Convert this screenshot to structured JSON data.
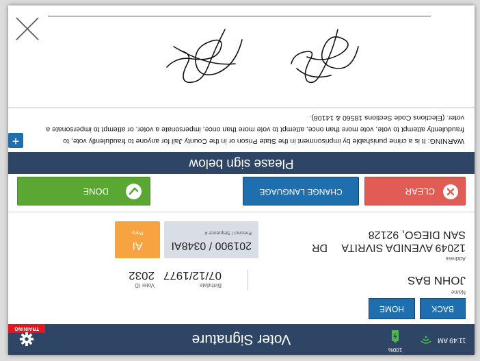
{
  "header": {
    "title": "Voter Signature",
    "training_label": "TRAINING",
    "battery_percent": "100%",
    "time": "11:49 AM",
    "colors": {
      "bar": "#2e4565",
      "training": "#e4161b"
    }
  },
  "nav": {
    "back_label": "BACK",
    "home_label": "HOME"
  },
  "voter": {
    "name_label": "Name",
    "name": "JOHN BAS",
    "birthdate_label": "Birthdate",
    "birthdate": "07/12/1977",
    "voter_id_label": "Voter ID",
    "voter_id": "2032",
    "address_label": "Address",
    "address_line1": "12049 AVENIDA SIVRITA",
    "address_dir": "DR",
    "address_line2": "SAN DIEGO, 92128",
    "precinct_label": "Precinct / Sequence #",
    "precinct": "201900 / 0348AI",
    "party_label": "Party",
    "party": "AI"
  },
  "actions": {
    "clear_label": "CLEAR",
    "change_language_label": "CHANGE LANGUAGE",
    "done_label": "DONE",
    "colors": {
      "clear": "#e25c56",
      "language": "#1f6fae",
      "done": "#5aa733"
    }
  },
  "sign": {
    "banner": "Please sign below",
    "expand_label": "+",
    "warning": "WARNING: It is a crime punishable by imprisonment in the State Prison or in the County Jail for anyone to fraudulently vote, to fraudulently attempt to vote, vote more than once, attempt to vote more than once, impersonate a voter, or attempt to impersonate a voter. (Elections Code Sections 18560 & 14108).",
    "close_icon": "close-x-icon"
  }
}
